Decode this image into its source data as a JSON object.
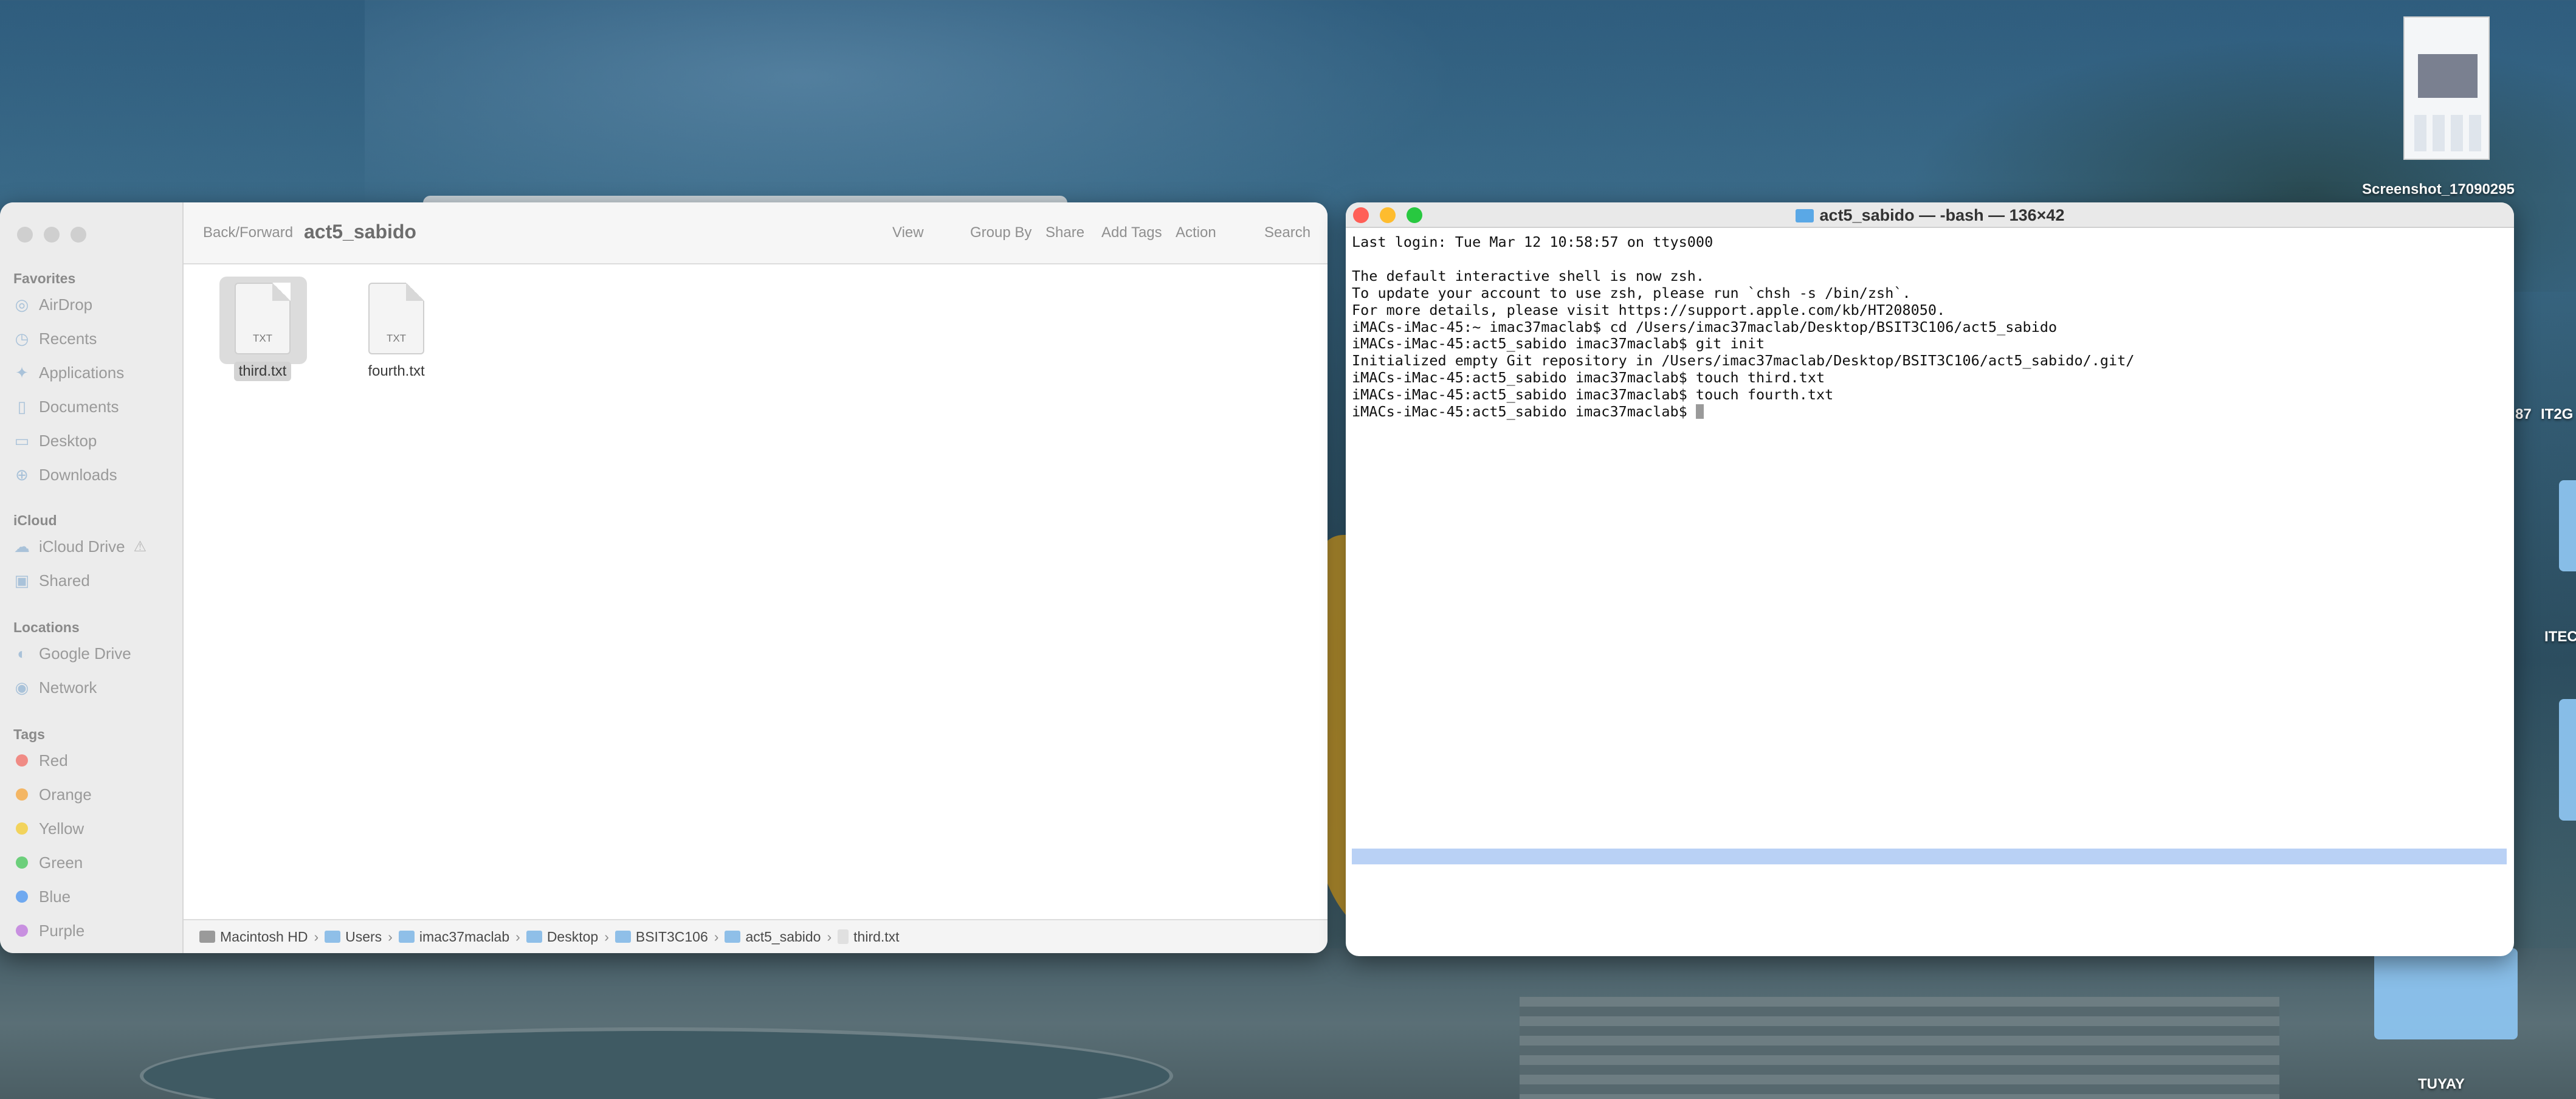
{
  "finder": {
    "title": "act5_sabido",
    "toolbar": {
      "back_forward": "Back/Forward",
      "view": "View",
      "group_by": "Group By",
      "share": "Share",
      "add_tags": "Add Tags",
      "action": "Action",
      "search": "Search"
    },
    "sidebar": {
      "favorites_header": "Favorites",
      "favorites": [
        {
          "label": "AirDrop",
          "icon": "airdrop-icon"
        },
        {
          "label": "Recents",
          "icon": "clock-icon"
        },
        {
          "label": "Applications",
          "icon": "applications-icon"
        },
        {
          "label": "Documents",
          "icon": "document-icon"
        },
        {
          "label": "Desktop",
          "icon": "desktop-icon"
        },
        {
          "label": "Downloads",
          "icon": "download-icon"
        }
      ],
      "icloud_header": "iCloud",
      "icloud": [
        {
          "label": "iCloud Drive",
          "icon": "cloud-icon"
        },
        {
          "label": "Shared",
          "icon": "shared-folder-icon"
        }
      ],
      "locations_header": "Locations",
      "locations": [
        {
          "label": "Google Drive",
          "icon": "drive-icon"
        },
        {
          "label": "Network",
          "icon": "network-icon"
        }
      ],
      "tags_header": "Tags",
      "tags": [
        {
          "label": "Red",
          "color": "#f08b85"
        },
        {
          "label": "Orange",
          "color": "#f4b664"
        },
        {
          "label": "Yellow",
          "color": "#f2d35c"
        },
        {
          "label": "Green",
          "color": "#6ccf7b"
        },
        {
          "label": "Blue",
          "color": "#6fa9f0"
        },
        {
          "label": "Purple",
          "color": "#c890e0"
        }
      ]
    },
    "files": [
      {
        "name": "third.txt",
        "ext": "TXT",
        "selected": true
      },
      {
        "name": "fourth.txt",
        "ext": "TXT",
        "selected": false
      }
    ],
    "path": [
      "Macintosh HD",
      "Users",
      "imac37maclab",
      "Desktop",
      "BSIT3C106",
      "act5_sabido",
      "third.txt"
    ]
  },
  "terminal": {
    "title": "act5_sabido — -bash — 136×42",
    "lines": [
      "Last login: Tue Mar 12 10:58:57 on ttys000",
      "",
      "The default interactive shell is now zsh.",
      "To update your account to use zsh, please run `chsh -s /bin/zsh`.",
      "For more details, please visit https://support.apple.com/kb/HT208050.",
      "iMACs-iMac-45:~ imac37maclab$ cd /Users/imac37maclab/Desktop/BSIT3C106/act5_sabido",
      "iMACs-iMac-45:act5_sabido imac37maclab$ git init",
      "Initialized empty Git repository in /Users/imac37maclab/Desktop/BSIT3C106/act5_sabido/.git/",
      "iMACs-iMac-45:act5_sabido imac37maclab$ touch third.txt",
      "iMACs-iMac-45:act5_sabido imac37maclab$ touch fourth.txt"
    ],
    "prompt": "iMACs-iMac-45:act5_sabido imac37maclab$ "
  },
  "desktop": {
    "screenshot_label": "Screenshot_17090295",
    "partial_label_1": "87",
    "partial_label_2": "IT2G",
    "partial_label_3": "ITEC",
    "folder_label": "TUYAY"
  }
}
